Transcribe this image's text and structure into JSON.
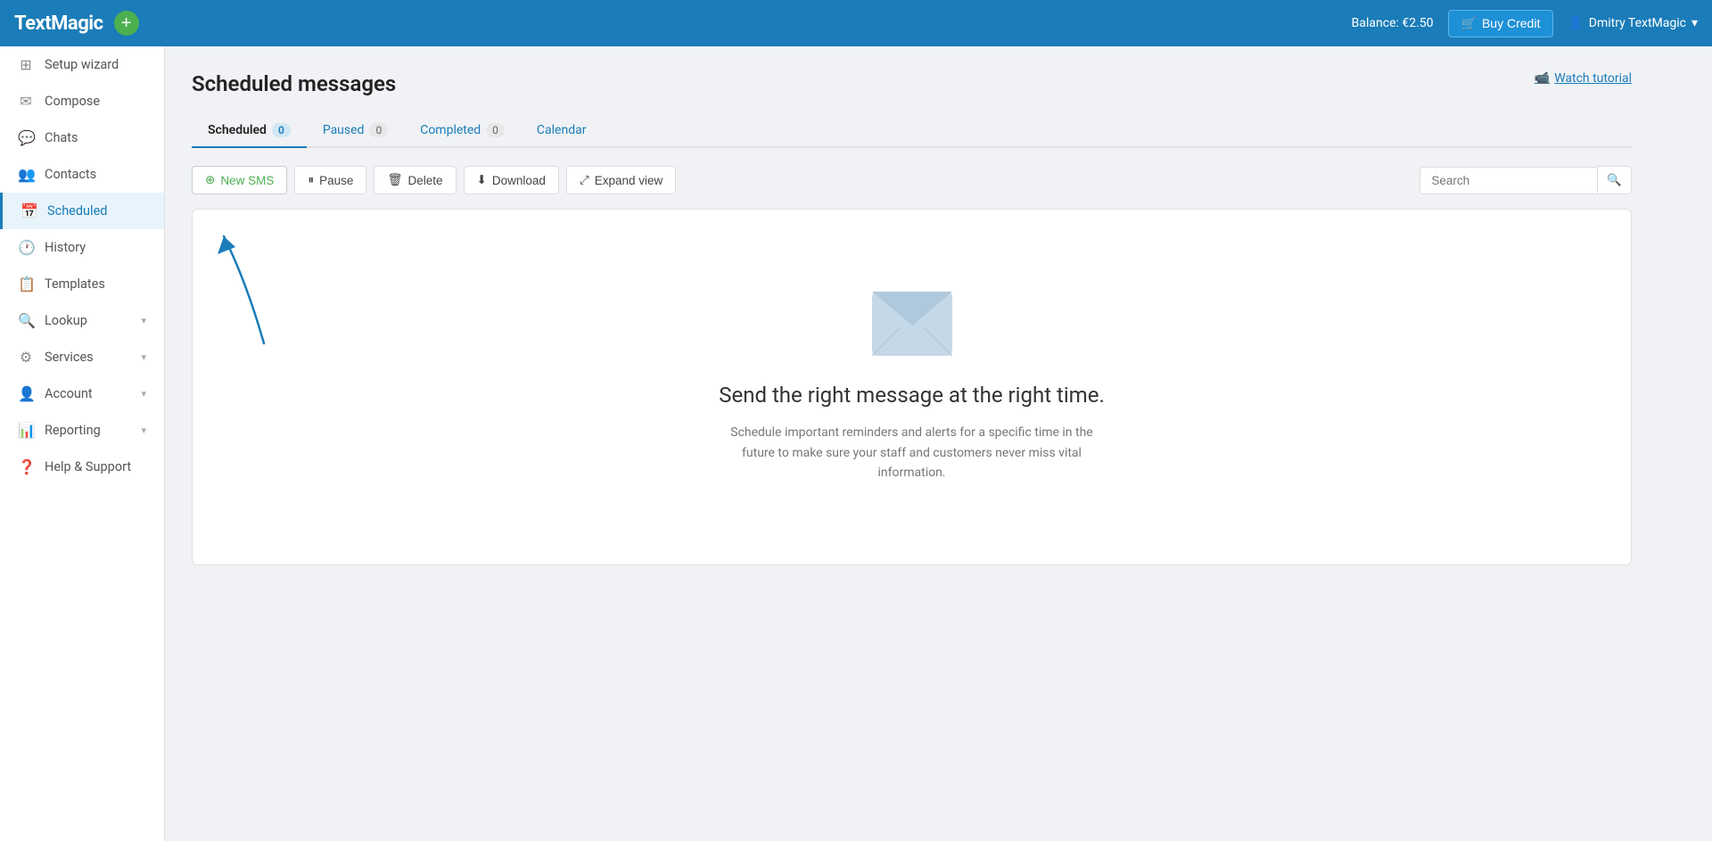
{
  "topnav": {
    "logo": "TextMagic",
    "balance_label": "Balance: €2.50",
    "buy_credit_label": "Buy Credit",
    "user_label": "Dmitry TextMagic"
  },
  "sidebar": {
    "items": [
      {
        "id": "setup-wizard",
        "label": "Setup wizard",
        "icon": "⊞",
        "hasChevron": false
      },
      {
        "id": "compose",
        "label": "Compose",
        "icon": "✉",
        "hasChevron": false
      },
      {
        "id": "chats",
        "label": "Chats",
        "icon": "💬",
        "hasChevron": false
      },
      {
        "id": "contacts",
        "label": "Contacts",
        "icon": "👥",
        "hasChevron": false
      },
      {
        "id": "scheduled",
        "label": "Scheduled",
        "icon": "📅",
        "hasChevron": false,
        "active": true
      },
      {
        "id": "history",
        "label": "History",
        "icon": "🕐",
        "hasChevron": false
      },
      {
        "id": "templates",
        "label": "Templates",
        "icon": "📋",
        "hasChevron": false
      },
      {
        "id": "lookup",
        "label": "Lookup",
        "icon": "🔍",
        "hasChevron": true
      },
      {
        "id": "services",
        "label": "Services",
        "icon": "⚙",
        "hasChevron": true
      },
      {
        "id": "account",
        "label": "Account",
        "icon": "👤",
        "hasChevron": true
      },
      {
        "id": "reporting",
        "label": "Reporting",
        "icon": "📊",
        "hasChevron": true
      },
      {
        "id": "help",
        "label": "Help & Support",
        "icon": "❓",
        "hasChevron": false
      }
    ]
  },
  "page": {
    "title": "Scheduled messages",
    "watch_tutorial": "Watch tutorial",
    "tabs": [
      {
        "id": "scheduled",
        "label": "Scheduled",
        "count": "0",
        "active": true
      },
      {
        "id": "paused",
        "label": "Paused",
        "count": "0",
        "active": false
      },
      {
        "id": "completed",
        "label": "Completed",
        "count": "0",
        "active": false
      },
      {
        "id": "calendar",
        "label": "Calendar",
        "count": null,
        "active": false
      }
    ],
    "toolbar": {
      "new_sms": "New SMS",
      "pause": "Pause",
      "delete": "Delete",
      "download": "Download",
      "expand_view": "Expand view",
      "search_placeholder": "Search"
    },
    "empty_state": {
      "title": "Send the right message at the right time.",
      "description": "Schedule important reminders and alerts for a specific time in the future to make sure your staff and customers never miss vital information."
    }
  }
}
